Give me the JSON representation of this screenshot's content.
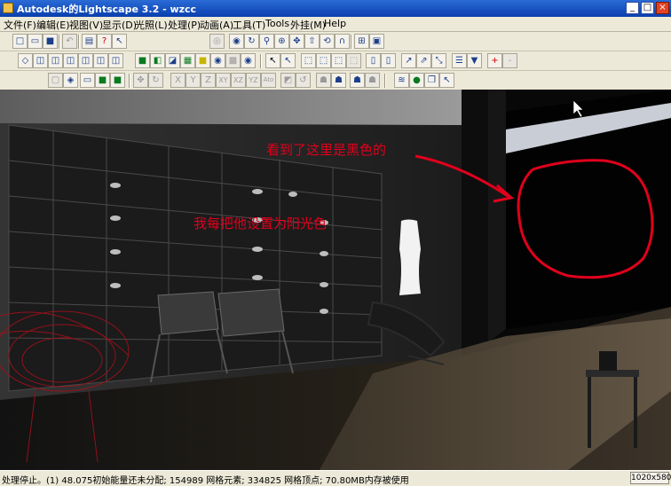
{
  "window": {
    "title": "Autodesk的Lightscape 3.2 - wzcc",
    "minimize": "_",
    "maximize": "□",
    "close": "×"
  },
  "menu": [
    "文件(F)",
    "编辑(E)",
    "视图(V)",
    "显示(D)",
    "光照(L)",
    "处理(P)",
    "动画(A)",
    "工具(T)",
    "Tools",
    "外挂(M)",
    "Help"
  ],
  "toolbar_axis_labels": [
    "X",
    "Y",
    "Z",
    "XY",
    "XZ",
    "YZ",
    "Ato"
  ],
  "toolbar_help_glyph": "?",
  "annotations": {
    "note_black": "看到了这里是黑色的",
    "note_sunlight": "我每把他设置为阳光色"
  },
  "status": {
    "message": "处理停止。(1) 48.075初始能量还未分配; 154989 网格元素; 334825 网格顶点; 70.80MB内存被使用",
    "resolution": "1020x580"
  },
  "colors": {
    "title_bar": "#0a3fae",
    "chrome": "#ece9d8",
    "annotation_red": "#e0001c"
  }
}
